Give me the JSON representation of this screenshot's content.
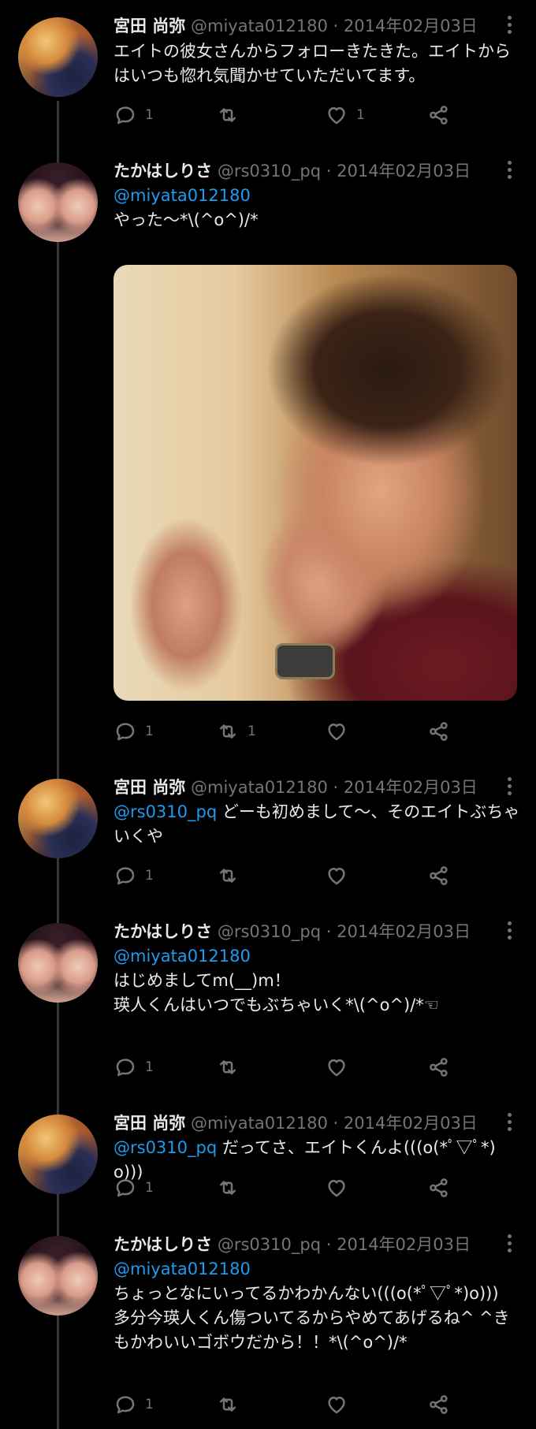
{
  "tweets": [
    {
      "name": "宮田 尚弥",
      "handle": "@miyata012180",
      "sep": "·",
      "date": "2014年02月03日",
      "reply_to": "",
      "text": "エイトの彼女さんからフォローきたきた。エイトからはいつも惚れ気聞かせていただいてます。",
      "replies": "1",
      "retweets": "",
      "likes": "1"
    },
    {
      "name": "たかはしりさ",
      "handle": "@rs0310_pq",
      "sep": "·",
      "date": "2014年02月03日",
      "reply_to": "@miyata012180",
      "text": "\nやった〜*\\(^o^)/*",
      "replies": "1",
      "retweets": "1",
      "likes": ""
    },
    {
      "name": "宮田 尚弥",
      "handle": "@miyata012180",
      "sep": "·",
      "date": "2014年02月03日",
      "reply_to": "@rs0310_pq",
      "text": "どーも初めまして〜、そのエイトぶちゃいくや",
      "replies": "1",
      "retweets": "",
      "likes": ""
    },
    {
      "name": "たかはしりさ",
      "handle": "@rs0310_pq",
      "sep": "·",
      "date": "2014年02月03日",
      "reply_to": "@miyata012180",
      "text": "\nはじめましてm(__)m！\n瑛人くんはいつでもぶちゃいく*\\(^o^)/*☜",
      "replies": "1",
      "retweets": "",
      "likes": ""
    },
    {
      "name": "宮田 尚弥",
      "handle": "@miyata012180",
      "sep": "·",
      "date": "2014年02月03日",
      "reply_to": "@rs0310_pq",
      "text": "だってさ、エイトくんよ(((o(*ﾟ▽ﾟ*)o)))",
      "replies": "1",
      "retweets": "",
      "likes": ""
    },
    {
      "name": "たかはしりさ",
      "handle": "@rs0310_pq",
      "sep": "·",
      "date": "2014年02月03日",
      "reply_to": "@miyata012180",
      "text": "\nちょっとなにいってるかわかんない(((o(*ﾟ▽ﾟ*)o)))\n多分今瑛人くん傷ついてるからやめてあげるね^ ^きもかわいいゴボウだから！！*\\(^o^)/*",
      "replies": "1",
      "retweets": "",
      "likes": ""
    }
  ],
  "icons": {
    "reply": "reply-icon",
    "retweet": "retweet-icon",
    "like": "heart-icon",
    "share": "share-icon",
    "more": "more-icon"
  },
  "colors": {
    "background": "#000000",
    "text": "#e7e9ea",
    "secondary": "#71767b",
    "mention": "#1d9bf0"
  }
}
